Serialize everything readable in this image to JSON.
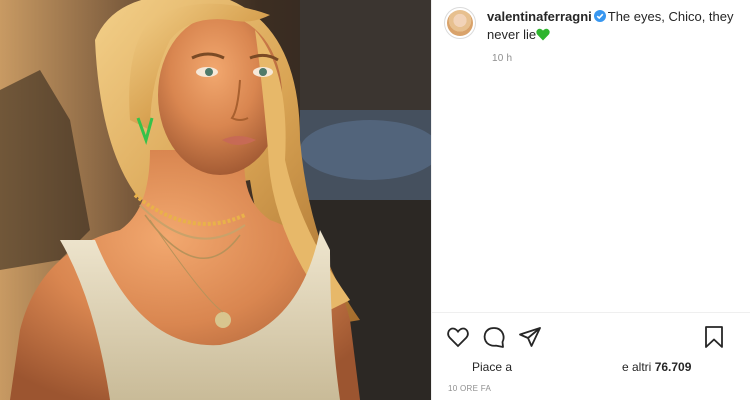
{
  "post": {
    "image": {
      "alt_icon": "portrait-photo"
    },
    "author": {
      "username": "valentinaferragni",
      "verified_icon": "verified-badge-icon",
      "verified_color": "#3897f0"
    },
    "caption": {
      "text": "The eyes, Chico, they never lie",
      "emoji_icon": "green-heart-icon",
      "emoji_color": "#2fb52f"
    },
    "time_ago": "10 h",
    "actions": {
      "like_icon": "heart-icon",
      "comment_icon": "comment-icon",
      "share_icon": "send-icon",
      "save_icon": "bookmark-icon"
    },
    "likes": {
      "prefix": "Piace a",
      "suffix": "e altri",
      "count": "76.709"
    },
    "date": "10 ORE FA"
  }
}
